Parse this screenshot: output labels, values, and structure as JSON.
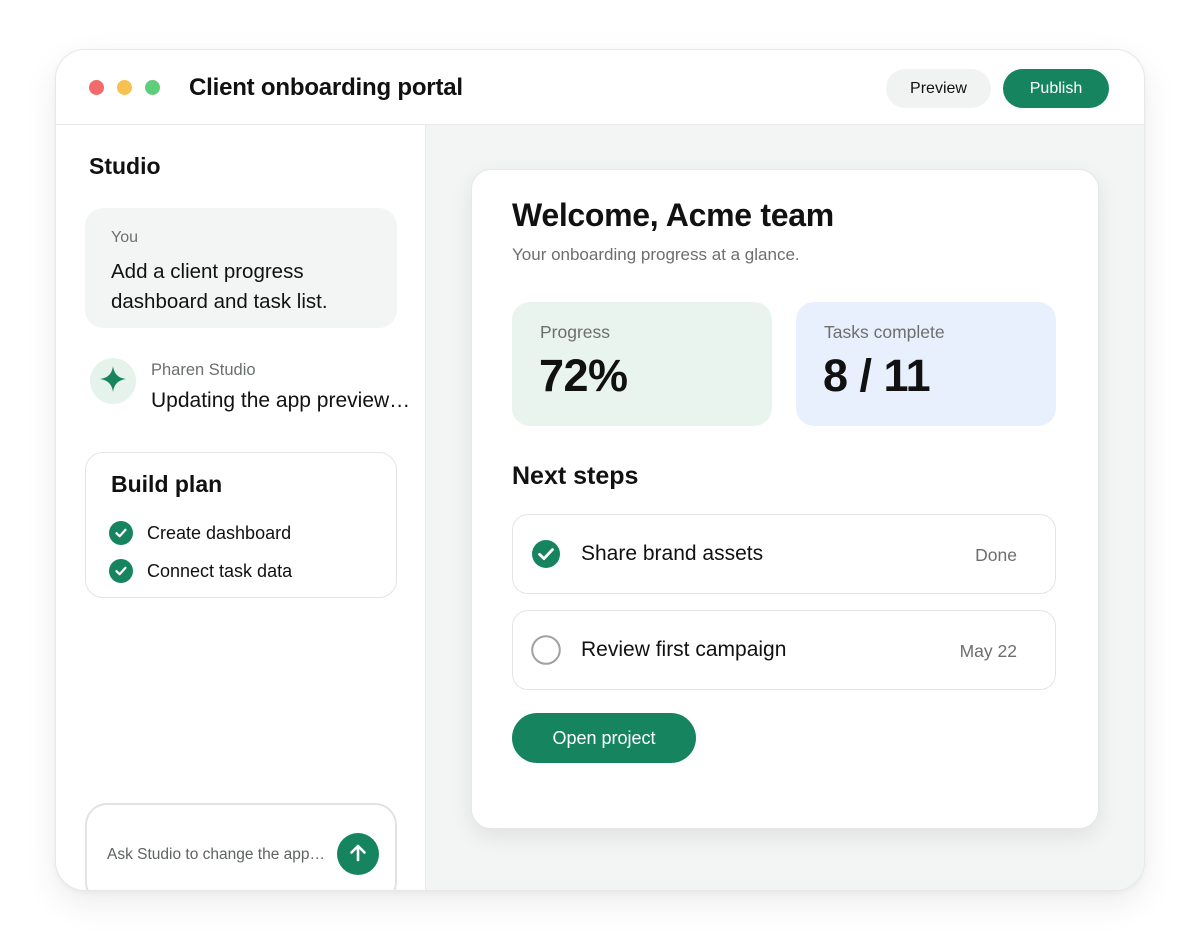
{
  "app": {
    "title": "Client onboarding portal",
    "preview_label": "Preview",
    "publish_label": "Publish"
  },
  "sidebar": {
    "title": "Studio",
    "user_message": {
      "author": "You",
      "text": "Add a client progress dashboard and task list."
    },
    "assistant_message": {
      "author": "Pharen Studio",
      "text": "Updating the app preview…",
      "icon": "sparkle-icon"
    },
    "build_plan": {
      "title": "Build plan",
      "items": [
        {
          "label": "Create dashboard",
          "done": true
        },
        {
          "label": "Connect task data",
          "done": true
        }
      ]
    },
    "composer": {
      "placeholder": "Ask Studio to change the app…",
      "send_icon": "arrow-up-icon"
    }
  },
  "preview": {
    "heading": "Welcome, Acme team",
    "subtitle": "Your onboarding progress at a glance.",
    "stats": [
      {
        "label": "Progress",
        "value": "72%"
      },
      {
        "label": "Tasks complete",
        "value": "8 / 11"
      }
    ],
    "next_steps_title": "Next steps",
    "steps": [
      {
        "label": "Share brand assets",
        "meta": "Done",
        "done": true
      },
      {
        "label": "Review first campaign",
        "meta": "May 22",
        "done": false
      }
    ],
    "open_label": "Open project"
  },
  "colors": {
    "accent": "#16855f",
    "progress_bg": "#e8f4ed",
    "tasks_bg": "#e8f0fd",
    "panel_bg": "#f3f5f4"
  }
}
